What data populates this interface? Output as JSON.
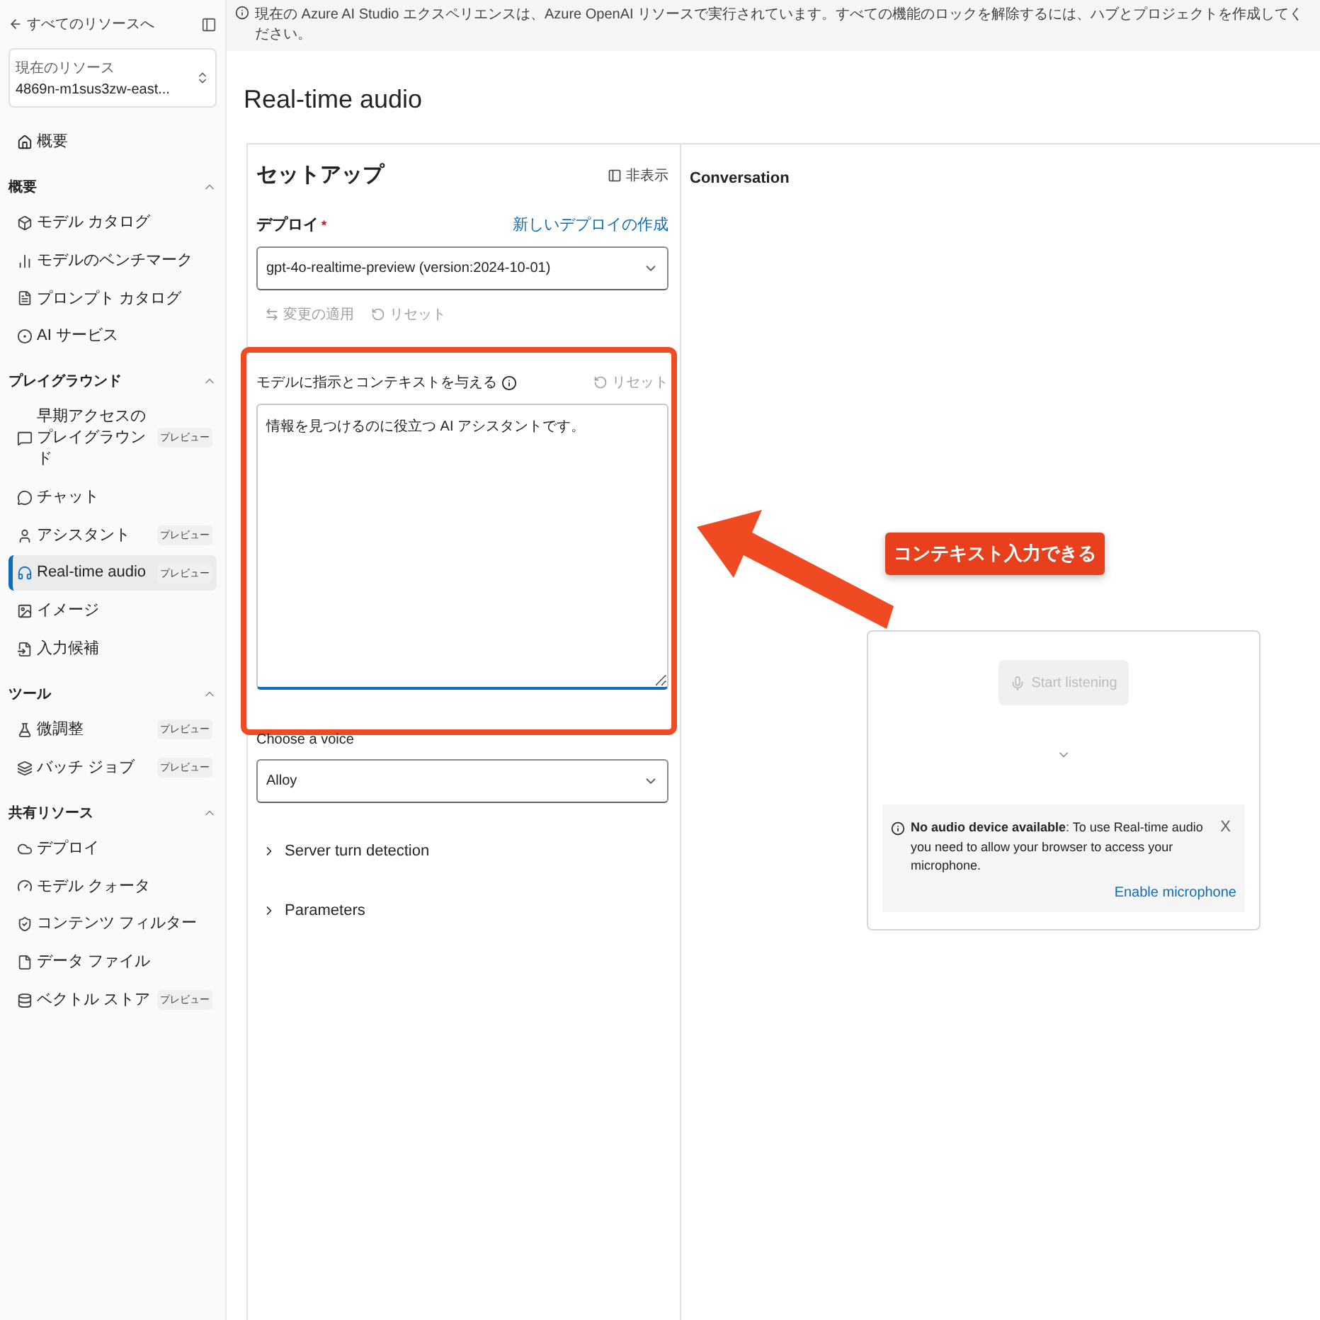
{
  "banner": {
    "text": "現在の Azure AI Studio エクスペリエンスは、Azure OpenAI リソースで実行されています。すべての機能のロックを解除するには、ハブとプロジェクトを作成してください。"
  },
  "sidebar": {
    "back_link": "すべてのリソースへ",
    "resource": {
      "label": "現在のリソース",
      "name": "4869n-m1sus3zw-east..."
    },
    "home": {
      "label": "概要",
      "selected": false
    },
    "sections": [
      {
        "title": "概要",
        "expanded": true,
        "items": [
          {
            "label": "モデル カタログ",
            "selected": false
          },
          {
            "label": "モデルのベンチマーク",
            "selected": false
          },
          {
            "label": "プロンプト カタログ",
            "selected": false
          },
          {
            "label": "AI サービス",
            "selected": false
          }
        ]
      },
      {
        "title": "プレイグラウンド",
        "expanded": true,
        "items": [
          {
            "label": "早期アクセスのプレイグラウンド",
            "badge": "プレビュー",
            "selected": false
          },
          {
            "label": "チャット",
            "selected": false
          },
          {
            "label": "アシスタント",
            "badge": "プレビュー",
            "selected": false
          },
          {
            "label": "Real-time audio",
            "badge": "プレビュー",
            "selected": true
          },
          {
            "label": "イメージ",
            "selected": false
          },
          {
            "label": "入力候補",
            "selected": false
          }
        ]
      },
      {
        "title": "ツール",
        "expanded": true,
        "items": [
          {
            "label": "微調整",
            "badge": "プレビュー",
            "selected": false
          },
          {
            "label": "バッチ ジョブ",
            "badge": "プレビュー",
            "selected": false
          }
        ]
      },
      {
        "title": "共有リソース",
        "expanded": true,
        "items": [
          {
            "label": "デプロイ",
            "selected": false
          },
          {
            "label": "モデル クォータ",
            "selected": false
          },
          {
            "label": "コンテンツ フィルター",
            "selected": false
          },
          {
            "label": "データ ファイル",
            "selected": false
          },
          {
            "label": "ベクトル ストア",
            "badge": "プレビュー",
            "selected": false
          }
        ]
      }
    ]
  },
  "page": {
    "title": "Real-time audio"
  },
  "setup": {
    "title": "セットアップ",
    "hide_button": "非表示",
    "deploy_label": "デプロイ",
    "required_mark": "*",
    "new_deploy_link": "新しいデプロイの作成",
    "deployment": "gpt-4o-realtime-preview (version:2024-10-01)",
    "apply_button": {
      "label": "変更の適用",
      "disabled": true
    },
    "reset_button": {
      "label": "リセット",
      "disabled": true
    },
    "system_message": {
      "label": "モデルに指示とコンテキストを与える",
      "reset": "リセット",
      "value": "情報を見つけるのに役立つ AI アシスタントです。"
    },
    "voice_label": "Choose a voice",
    "voice": "Alloy",
    "sections": [
      {
        "label": "Server turn detection",
        "expanded": false
      },
      {
        "label": "Parameters",
        "expanded": false
      }
    ]
  },
  "conversation": {
    "title": "Conversation",
    "start_button": {
      "label": "Start listening",
      "disabled": true
    },
    "notice": {
      "text": "**No audio device available**: To use Real-time audio you need to allow your browser to access your microphone.",
      "close": "X",
      "link": "Enable microphone"
    }
  },
  "annotation": {
    "callout": "コンテキスト入力できる"
  }
}
